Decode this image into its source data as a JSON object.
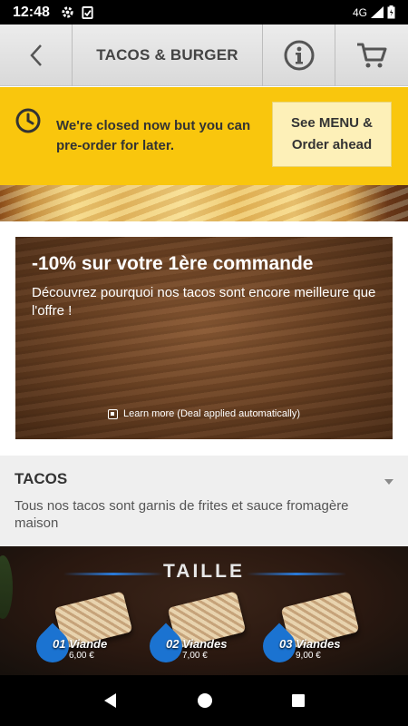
{
  "status_bar": {
    "time": "12:48",
    "network": "4G"
  },
  "header": {
    "title": "TACOS & BURGER",
    "back_icon": "chevron-left-icon",
    "info_icon": "info-icon",
    "cart_icon": "cart-icon"
  },
  "closed_banner": {
    "message": "We're closed now but you can pre-order for later.",
    "button_label": "See MENU & Order ahead",
    "background_color": "#f9c60d"
  },
  "promo": {
    "title": "-10% sur votre 1ère commande",
    "description": "Découvrez pourquoi nos tacos sont encore meilleure que l'offre !",
    "learn_more": "Learn more (Deal applied automatically)"
  },
  "category": {
    "title": "TACOS",
    "description": "Tous nos tacos sont garnis de frites et sauce fromagère maison"
  },
  "taille_banner": {
    "title": "TAILLE",
    "sizes": [
      {
        "label": "01 Viande",
        "price": "6,00 €"
      },
      {
        "label": "02 Viandes",
        "price": "7,00 €"
      },
      {
        "label": "03 Viandes",
        "price": "9,00 €"
      }
    ]
  }
}
